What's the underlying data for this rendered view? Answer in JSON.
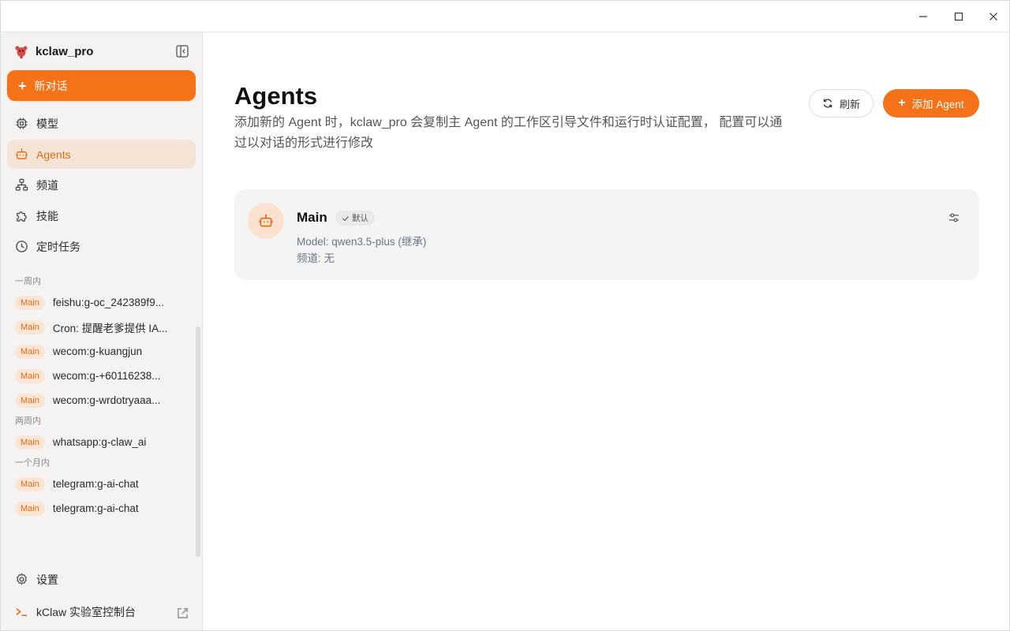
{
  "window": {
    "controls": [
      "minimize-icon",
      "maximize-icon",
      "close-icon"
    ]
  },
  "sidebar": {
    "brand_name": "kclaw_pro",
    "new_chat_label": "新对话",
    "nav": [
      {
        "label": "模型",
        "icon": "chip-icon",
        "active": false
      },
      {
        "label": "Agents",
        "icon": "robot-icon",
        "active": true
      },
      {
        "label": "频道",
        "icon": "network-icon",
        "active": false
      },
      {
        "label": "技能",
        "icon": "puzzle-icon",
        "active": false
      },
      {
        "label": "定时任务",
        "icon": "clock-icon",
        "active": false
      }
    ],
    "history": [
      {
        "group": "一周内",
        "items": [
          {
            "tag": "Main",
            "title": "feishu:g-oc_242389f9..."
          },
          {
            "tag": "Main",
            "title": "Cron: 提醒老爹提供 IA..."
          },
          {
            "tag": "Main",
            "title": "wecom:g-kuangjun"
          },
          {
            "tag": "Main",
            "title": "wecom:g-+60116238..."
          },
          {
            "tag": "Main",
            "title": "wecom:g-wrdotryaaa..."
          }
        ]
      },
      {
        "group": "两周内",
        "items": [
          {
            "tag": "Main",
            "title": "whatsapp:g-claw_ai"
          }
        ]
      },
      {
        "group": "一个月内",
        "items": [
          {
            "tag": "Main",
            "title": "telegram:g-ai-chat"
          },
          {
            "tag": "Main",
            "title": "telegram:g-ai-chat"
          }
        ]
      }
    ],
    "settings_label": "设置",
    "console_label": "kClaw 实验室控制台"
  },
  "main": {
    "title": "Agents",
    "description": "添加新的 Agent 时，kclaw_pro 会复制主 Agent 的工作区引导文件和运行时认证配置， 配置可以通过以对话的形式进行修改",
    "refresh_label": "刷新",
    "add_label": "添加 Agent",
    "agents": [
      {
        "name": "Main",
        "badge": "默认",
        "model": "Model: qwen3.5-plus (继承)",
        "channel": "频道: 无"
      }
    ]
  },
  "colors": {
    "accent": "#f57218",
    "accent_soft": "#fbe5d4",
    "sidebar_bg": "#f4f3f1",
    "card_bg": "#f4f4f4"
  }
}
